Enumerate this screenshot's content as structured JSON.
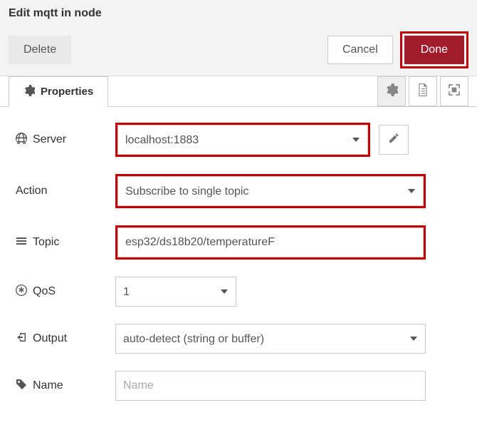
{
  "header": {
    "title": "Edit mqtt in node",
    "delete_label": "Delete",
    "cancel_label": "Cancel",
    "done_label": "Done"
  },
  "tabs": {
    "properties_label": "Properties"
  },
  "form": {
    "server": {
      "label": "Server",
      "value": "localhost:1883"
    },
    "action": {
      "label": "Action",
      "value": "Subscribe to single topic"
    },
    "topic": {
      "label": "Topic",
      "value": "esp32/ds18b20/temperatureF"
    },
    "qos": {
      "label": "QoS",
      "value": "1"
    },
    "output": {
      "label": "Output",
      "value": "auto-detect (string or buffer)"
    },
    "name": {
      "label": "Name",
      "placeholder": "Name",
      "value": ""
    }
  }
}
